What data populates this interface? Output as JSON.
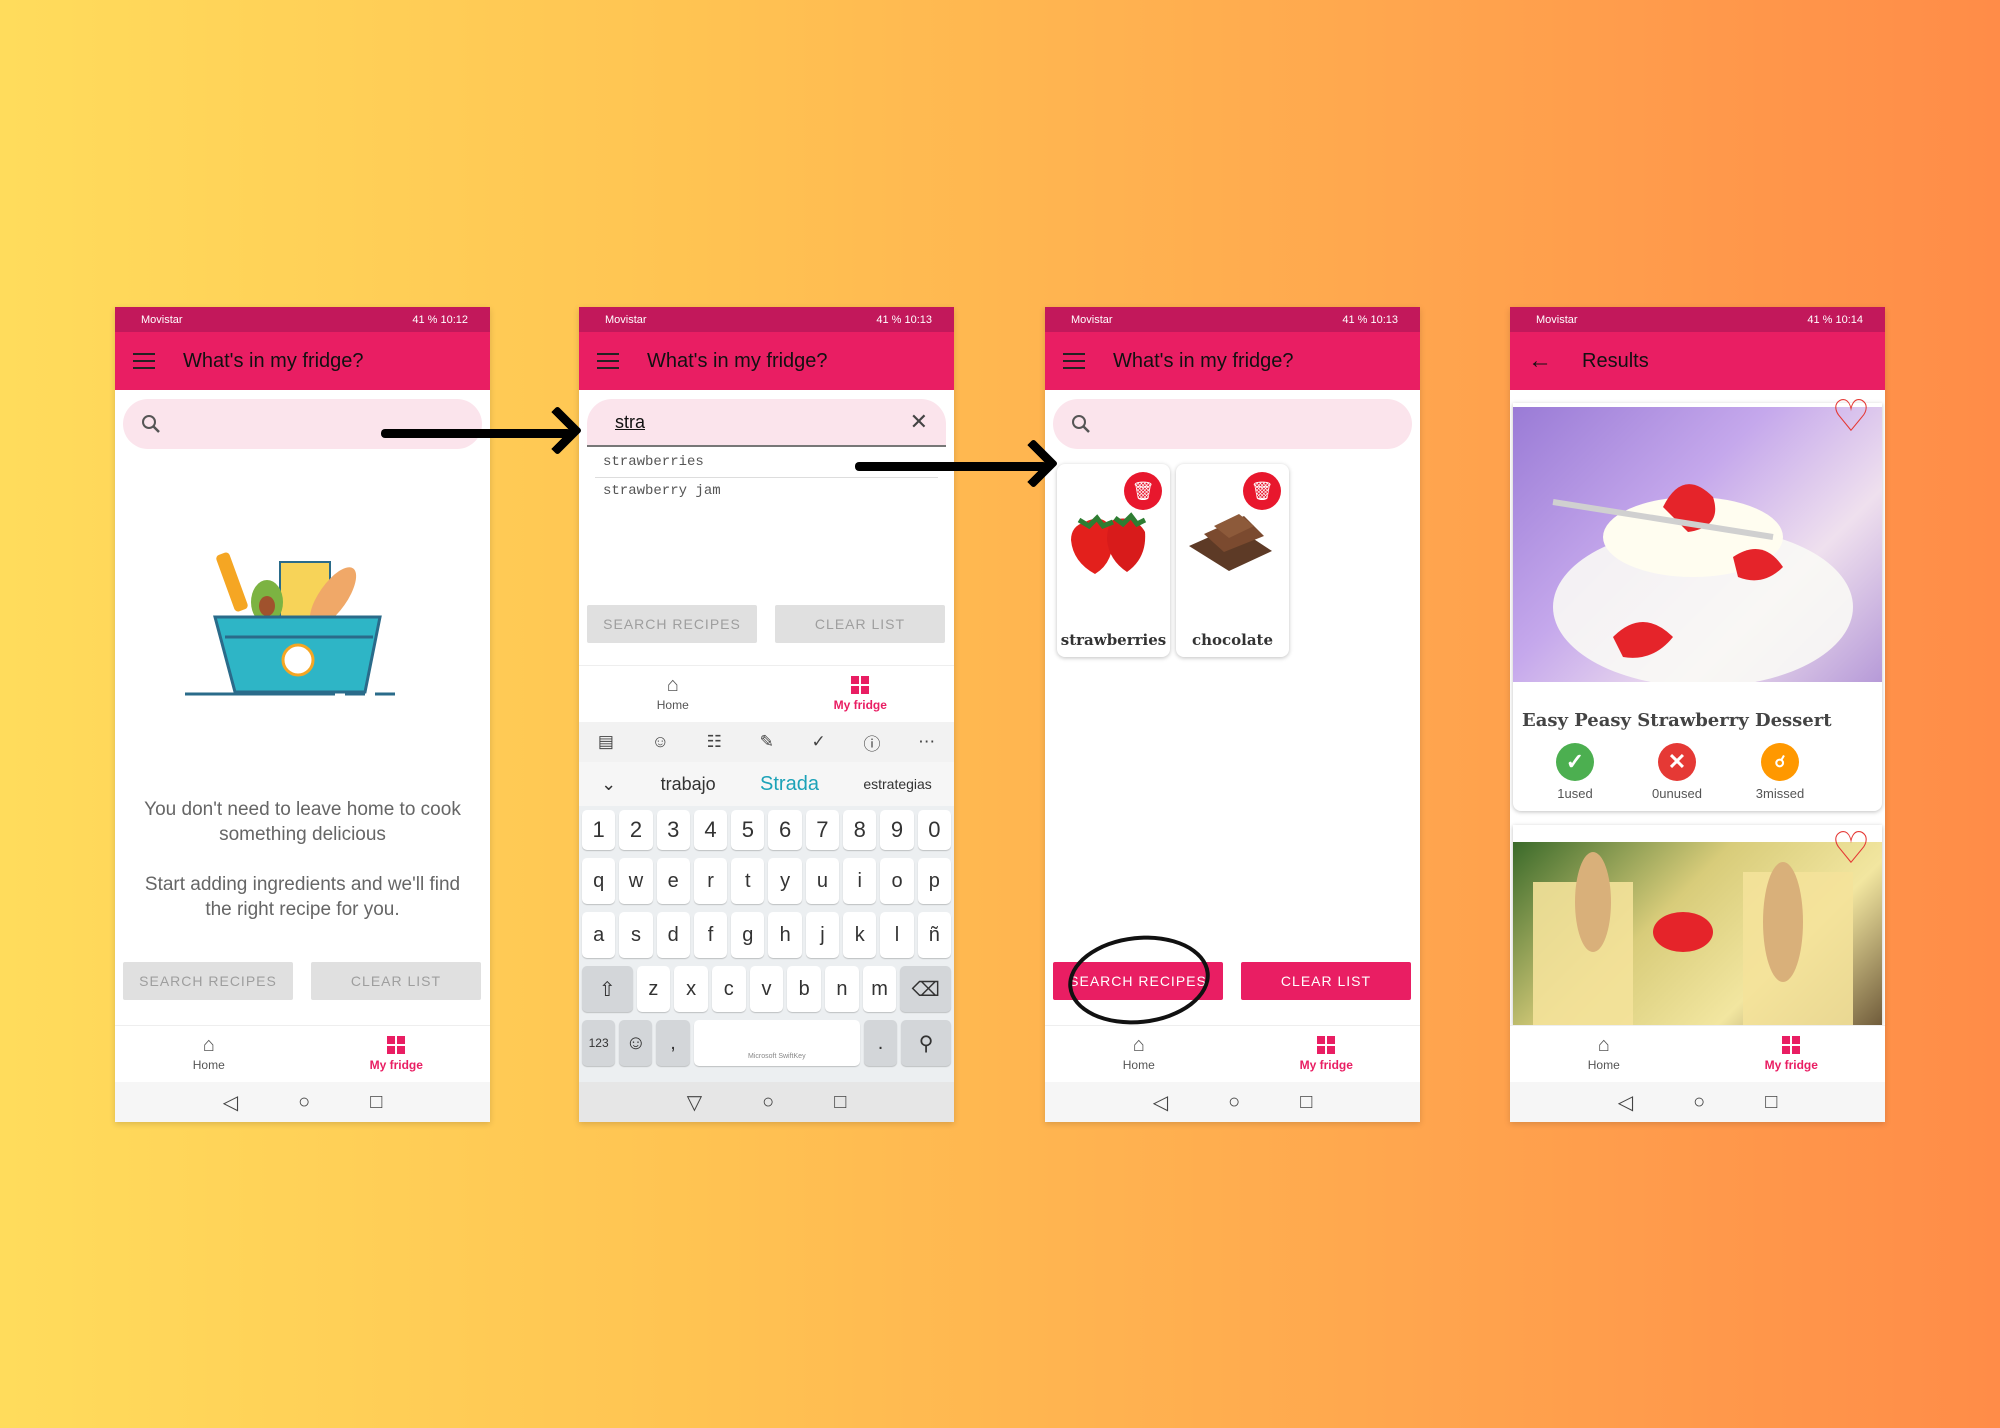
{
  "status": {
    "carrier": "Movistar",
    "battery": "41 %",
    "times": [
      "10:12",
      "10:13",
      "10:13",
      "10:14"
    ]
  },
  "screens": {
    "fridge_title": "What's in my fridge?",
    "results_title": "Results"
  },
  "screen1": {
    "empty_line1": "You don't need to leave home to cook something delicious",
    "empty_line2": "Start adding ingredients and we'll find the right recipe for you."
  },
  "screen2": {
    "query": "stra",
    "suggestions": [
      "strawberries",
      "strawberry jam"
    ],
    "keyboard": {
      "suggestions": [
        "trabajo",
        "Strada",
        "estrategias"
      ],
      "numbers": [
        "1",
        "2",
        "3",
        "4",
        "5",
        "6",
        "7",
        "8",
        "9",
        "0"
      ],
      "row1": [
        "q",
        "w",
        "e",
        "r",
        "t",
        "y",
        "u",
        "i",
        "o",
        "p"
      ],
      "row2": [
        "a",
        "s",
        "d",
        "f",
        "g",
        "h",
        "j",
        "k",
        "l",
        "ñ"
      ],
      "row3": [
        "z",
        "x",
        "c",
        "v",
        "b",
        "n",
        "m"
      ],
      "numkey": "123",
      "space_brand": "Microsoft SwiftKey"
    }
  },
  "screen3": {
    "ingredients": [
      "strawberries",
      "chocolate"
    ]
  },
  "screen4": {
    "recipe_title": "Easy Peasy Strawberry Dessert",
    "used": "1used",
    "unused": "0unused",
    "missed": "3missed"
  },
  "buttons": {
    "search": "SEARCH RECIPES",
    "clear": "CLEAR LIST"
  },
  "nav": {
    "home": "Home",
    "fridge": "My fridge"
  },
  "colors": {
    "primary": "#e91e63",
    "status_bar": "#c2185b",
    "search_bg": "#fbe4ec",
    "delete": "#e8172d",
    "used": "#4caf50",
    "unused": "#e53935",
    "missed": "#ff9800"
  }
}
